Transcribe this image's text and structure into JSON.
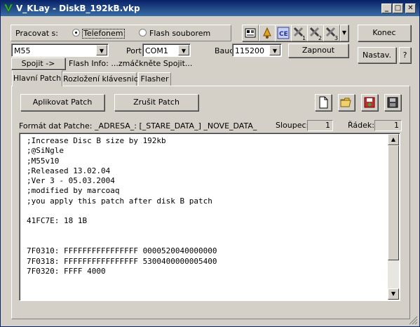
{
  "window": {
    "title": "V_KLay - DiskB_192kB.vkp"
  },
  "connection": {
    "work_with_label": "Pracovat s:",
    "radio_phone_label": "Telefonem",
    "radio_flash_label": "Flash souborem",
    "selected": "phone",
    "model_value": "M55",
    "port_label": "Port",
    "port_value": "COM1",
    "baud_label": "Baud",
    "baud_value": "115200",
    "enable_button": "Zapnout",
    "connect_button": "Spojit ->",
    "flash_info": "Flash Info: ...zmáčkněte Spojit..."
  },
  "side_buttons": {
    "close": "Konec",
    "settings": "Nastav.",
    "help": "?"
  },
  "toolbar": {
    "icons": [
      "phone-book-icon",
      "bell-icon",
      "ce-icon",
      "tool-1-icon",
      "tool-2-icon",
      "tool-3-icon"
    ],
    "tool_numbers": [
      "1",
      "2",
      "3"
    ],
    "ce_text": "CE"
  },
  "tabs": [
    {
      "label": "Hlavní Patch",
      "active": true
    },
    {
      "label": "Rozložení klávesnice",
      "active": false
    },
    {
      "label": "Flasher",
      "active": false
    }
  ],
  "patch": {
    "apply_button": "Aplikovat Patch",
    "cancel_button": "Zrušit Patch",
    "format_label": "Formát dat Patche: _ADRESA_: [_STARE_DATA_] _NOVE_DATA_",
    "column_label": "Sloupec:",
    "column_value": "1",
    "row_label": "Řádek:",
    "row_value": "1",
    "code_lines": [
      ";Increase Disc B size by 192kb",
      ";@SiNgle",
      ";M55v10",
      ";Released 13.02.04",
      ";Ver 3 - 05.03.2004",
      ";modified by marcoaq",
      ";you apply this patch after disk B patch",
      "",
      "41FC7E: 18 1B",
      "",
      "",
      "7F0310: FFFFFFFFFFFFFFFF 0000520040000000",
      "7F0318: FFFFFFFFFFFFFFFF 5300400000005400",
      "7F0320: FFFF 4000"
    ]
  }
}
